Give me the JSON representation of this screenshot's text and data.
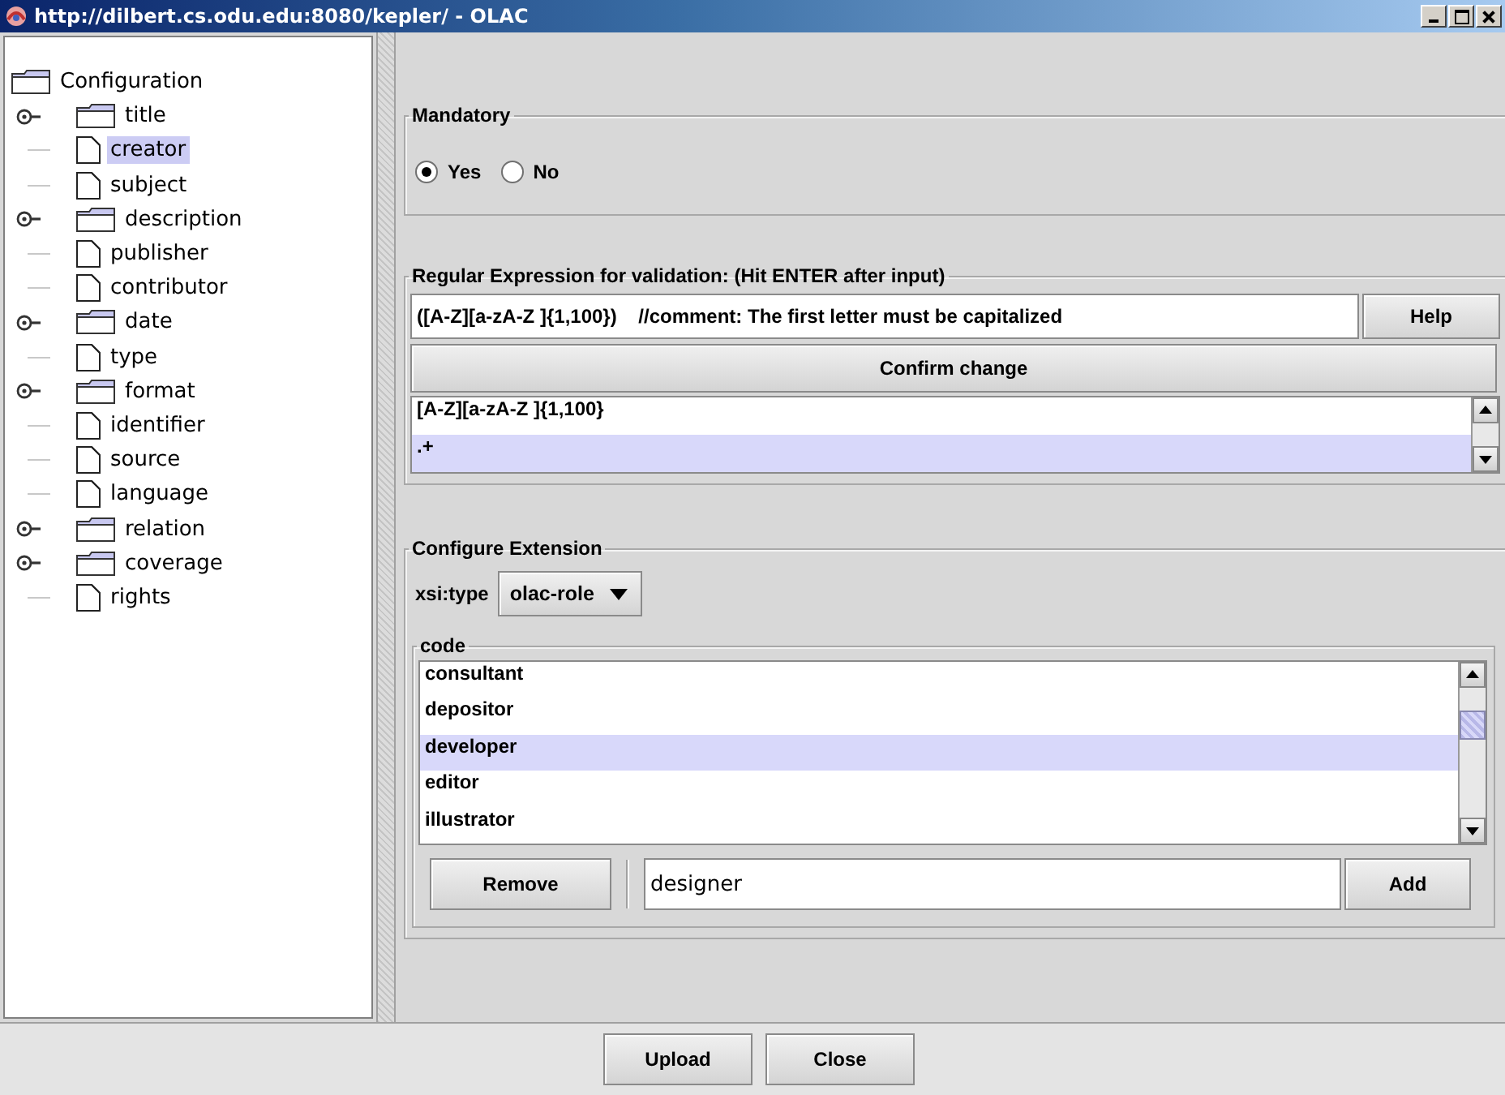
{
  "window": {
    "title": "http://dilbert.cs.odu.edu:8080/kepler/ - OLAC"
  },
  "tree": {
    "label": "Configuration",
    "kind": "folder",
    "selected": false,
    "children": [
      {
        "label": "title",
        "kind": "folder",
        "expanded": false,
        "selected": false
      },
      {
        "label": "creator",
        "kind": "leaf",
        "selected": true
      },
      {
        "label": "subject",
        "kind": "leaf",
        "selected": false
      },
      {
        "label": "description",
        "kind": "folder",
        "expanded": false,
        "selected": false
      },
      {
        "label": "publisher",
        "kind": "leaf",
        "selected": false
      },
      {
        "label": "contributor",
        "kind": "leaf",
        "selected": false
      },
      {
        "label": "date",
        "kind": "folder",
        "expanded": false,
        "selected": false
      },
      {
        "label": "type",
        "kind": "leaf",
        "selected": false
      },
      {
        "label": "format",
        "kind": "folder",
        "expanded": false,
        "selected": false
      },
      {
        "label": "identifier",
        "kind": "leaf",
        "selected": false
      },
      {
        "label": "source",
        "kind": "leaf",
        "selected": false
      },
      {
        "label": "language",
        "kind": "leaf",
        "selected": false
      },
      {
        "label": "relation",
        "kind": "folder",
        "expanded": false,
        "selected": false
      },
      {
        "label": "coverage",
        "kind": "folder",
        "expanded": false,
        "selected": false
      },
      {
        "label": "rights",
        "kind": "leaf",
        "selected": false
      }
    ]
  },
  "mandatory": {
    "legend": "Mandatory",
    "options": [
      {
        "label": "Yes",
        "selected": true
      },
      {
        "label": "No",
        "selected": false
      }
    ]
  },
  "regex": {
    "legend": "Regular Expression for validation: (Hit ENTER after input)",
    "value": "([A-Z][a-zA-Z ]{1,100})    //comment: The first letter must be capitalized",
    "help_button": "Help",
    "confirm_button": "Confirm change",
    "items": [
      {
        "text": "[A-Z][a-zA-Z ]{1,100}",
        "selected": false
      },
      {
        "text": ".+",
        "selected": true
      }
    ]
  },
  "extension": {
    "legend": "Configure Extension",
    "type_label": "xsi:type",
    "type_value": "olac-role",
    "code_legend": "code",
    "items": [
      {
        "text": "consultant",
        "selected": false
      },
      {
        "text": "depositor",
        "selected": false
      },
      {
        "text": "developer",
        "selected": true
      },
      {
        "text": "editor",
        "selected": false
      },
      {
        "text": "illustrator",
        "selected": false
      }
    ],
    "remove_button": "Remove",
    "value": "designer",
    "add_button": "Add"
  },
  "buttons": [
    "Upload",
    "Close"
  ]
}
